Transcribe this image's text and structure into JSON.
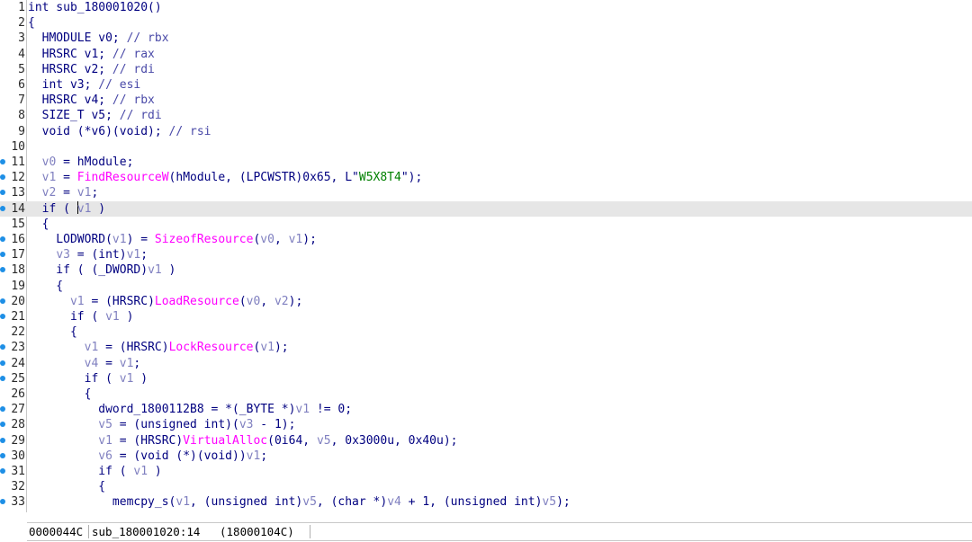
{
  "editor": {
    "function_name": "sub_180001020",
    "lines": [
      {
        "num": "1",
        "bp": false,
        "cur": false,
        "tokens": [
          [
            "int sub_180001020()",
            "k"
          ]
        ]
      },
      {
        "num": "2",
        "bp": false,
        "cur": false,
        "tokens": [
          [
            "{",
            "p"
          ]
        ]
      },
      {
        "num": "3",
        "bp": false,
        "cur": false,
        "tokens": [
          [
            "  HMODULE v0; ",
            "k"
          ],
          [
            "// rbx",
            "c"
          ]
        ]
      },
      {
        "num": "4",
        "bp": false,
        "cur": false,
        "tokens": [
          [
            "  HRSRC v1; ",
            "k"
          ],
          [
            "// rax",
            "c"
          ]
        ]
      },
      {
        "num": "5",
        "bp": false,
        "cur": false,
        "tokens": [
          [
            "  HRSRC v2; ",
            "k"
          ],
          [
            "// rdi",
            "c"
          ]
        ]
      },
      {
        "num": "6",
        "bp": false,
        "cur": false,
        "tokens": [
          [
            "  int v3; ",
            "k"
          ],
          [
            "// esi",
            "c"
          ]
        ]
      },
      {
        "num": "7",
        "bp": false,
        "cur": false,
        "tokens": [
          [
            "  HRSRC v4; ",
            "k"
          ],
          [
            "// rbx",
            "c"
          ]
        ]
      },
      {
        "num": "8",
        "bp": false,
        "cur": false,
        "tokens": [
          [
            "  SIZE_T v5; ",
            "k"
          ],
          [
            "// rdi",
            "c"
          ]
        ]
      },
      {
        "num": "9",
        "bp": false,
        "cur": false,
        "tokens": [
          [
            "  void (*v6)(void); ",
            "k"
          ],
          [
            "// rsi",
            "c"
          ]
        ]
      },
      {
        "num": "10",
        "bp": false,
        "cur": false,
        "tokens": []
      },
      {
        "num": "11",
        "bp": true,
        "cur": false,
        "tokens": [
          [
            "  ",
            "p"
          ],
          [
            "v0",
            "v"
          ],
          [
            " = hModule;",
            "k"
          ]
        ]
      },
      {
        "num": "12",
        "bp": true,
        "cur": false,
        "tokens": [
          [
            "  ",
            "p"
          ],
          [
            "v1",
            "v"
          ],
          [
            " = ",
            "k"
          ],
          [
            "FindResourceW",
            "f"
          ],
          [
            "(hModule, (LPCWSTR)0x65, L\"",
            "k"
          ],
          [
            "W5X8T4",
            "s"
          ],
          [
            "\");",
            "k"
          ]
        ]
      },
      {
        "num": "13",
        "bp": true,
        "cur": false,
        "tokens": [
          [
            "  ",
            "p"
          ],
          [
            "v2",
            "v"
          ],
          [
            " = ",
            "k"
          ],
          [
            "v1",
            "v"
          ],
          [
            ";",
            "k"
          ]
        ]
      },
      {
        "num": "14",
        "bp": true,
        "cur": true,
        "tokens": [
          [
            "  if ( ",
            "k"
          ],
          [
            "CARET",
            "caret"
          ],
          [
            "v1",
            "v"
          ],
          [
            " )",
            "k"
          ]
        ]
      },
      {
        "num": "15",
        "bp": false,
        "cur": false,
        "tokens": [
          [
            "  {",
            "p"
          ]
        ]
      },
      {
        "num": "16",
        "bp": true,
        "cur": false,
        "tokens": [
          [
            "    LODWORD(",
            "k"
          ],
          [
            "v1",
            "v"
          ],
          [
            ") = ",
            "k"
          ],
          [
            "SizeofResource",
            "f"
          ],
          [
            "(",
            "k"
          ],
          [
            "v0",
            "v"
          ],
          [
            ", ",
            "k"
          ],
          [
            "v1",
            "v"
          ],
          [
            ");",
            "k"
          ]
        ]
      },
      {
        "num": "17",
        "bp": true,
        "cur": false,
        "tokens": [
          [
            "    ",
            "p"
          ],
          [
            "v3",
            "v"
          ],
          [
            " = (int)",
            "k"
          ],
          [
            "v1",
            "v"
          ],
          [
            ";",
            "k"
          ]
        ]
      },
      {
        "num": "18",
        "bp": true,
        "cur": false,
        "tokens": [
          [
            "    if ( (_DWORD)",
            "k"
          ],
          [
            "v1",
            "v"
          ],
          [
            " )",
            "k"
          ]
        ]
      },
      {
        "num": "19",
        "bp": false,
        "cur": false,
        "tokens": [
          [
            "    {",
            "p"
          ]
        ]
      },
      {
        "num": "20",
        "bp": true,
        "cur": false,
        "tokens": [
          [
            "      ",
            "p"
          ],
          [
            "v1",
            "v"
          ],
          [
            " = (HRSRC)",
            "k"
          ],
          [
            "LoadResource",
            "f"
          ],
          [
            "(",
            "k"
          ],
          [
            "v0",
            "v"
          ],
          [
            ", ",
            "k"
          ],
          [
            "v2",
            "v"
          ],
          [
            ");",
            "k"
          ]
        ]
      },
      {
        "num": "21",
        "bp": true,
        "cur": false,
        "tokens": [
          [
            "      if ( ",
            "k"
          ],
          [
            "v1",
            "v"
          ],
          [
            " )",
            "k"
          ]
        ]
      },
      {
        "num": "22",
        "bp": false,
        "cur": false,
        "tokens": [
          [
            "      {",
            "p"
          ]
        ]
      },
      {
        "num": "23",
        "bp": true,
        "cur": false,
        "tokens": [
          [
            "        ",
            "p"
          ],
          [
            "v1",
            "v"
          ],
          [
            " = (HRSRC)",
            "k"
          ],
          [
            "LockResource",
            "f"
          ],
          [
            "(",
            "k"
          ],
          [
            "v1",
            "v"
          ],
          [
            ");",
            "k"
          ]
        ]
      },
      {
        "num": "24",
        "bp": true,
        "cur": false,
        "tokens": [
          [
            "        ",
            "p"
          ],
          [
            "v4",
            "v"
          ],
          [
            " = ",
            "k"
          ],
          [
            "v1",
            "v"
          ],
          [
            ";",
            "k"
          ]
        ]
      },
      {
        "num": "25",
        "bp": true,
        "cur": false,
        "tokens": [
          [
            "        if ( ",
            "k"
          ],
          [
            "v1",
            "v"
          ],
          [
            " )",
            "k"
          ]
        ]
      },
      {
        "num": "26",
        "bp": false,
        "cur": false,
        "tokens": [
          [
            "        {",
            "p"
          ]
        ]
      },
      {
        "num": "27",
        "bp": true,
        "cur": false,
        "tokens": [
          [
            "          dword_1800112B8 = *(_BYTE *)",
            "k"
          ],
          [
            "v1",
            "v"
          ],
          [
            " != 0;",
            "k"
          ]
        ]
      },
      {
        "num": "28",
        "bp": true,
        "cur": false,
        "tokens": [
          [
            "          ",
            "p"
          ],
          [
            "v5",
            "v"
          ],
          [
            " = (unsigned int)(",
            "k"
          ],
          [
            "v3",
            "v"
          ],
          [
            " - 1);",
            "k"
          ]
        ]
      },
      {
        "num": "29",
        "bp": true,
        "cur": false,
        "tokens": [
          [
            "          ",
            "p"
          ],
          [
            "v1",
            "v"
          ],
          [
            " = (HRSRC)",
            "k"
          ],
          [
            "VirtualAlloc",
            "f"
          ],
          [
            "(0i64, ",
            "k"
          ],
          [
            "v5",
            "v"
          ],
          [
            ", 0x3000u, 0x40u);",
            "k"
          ]
        ]
      },
      {
        "num": "30",
        "bp": true,
        "cur": false,
        "tokens": [
          [
            "          ",
            "p"
          ],
          [
            "v6",
            "v"
          ],
          [
            " = (void (*)(void))",
            "k"
          ],
          [
            "v1",
            "v"
          ],
          [
            ";",
            "k"
          ]
        ]
      },
      {
        "num": "31",
        "bp": true,
        "cur": false,
        "tokens": [
          [
            "          if ( ",
            "k"
          ],
          [
            "v1",
            "v"
          ],
          [
            " )",
            "k"
          ]
        ]
      },
      {
        "num": "32",
        "bp": false,
        "cur": false,
        "tokens": [
          [
            "          {",
            "p"
          ]
        ]
      },
      {
        "num": "33",
        "bp": true,
        "cur": false,
        "tokens": [
          [
            "            memcpy_s(",
            "k"
          ],
          [
            "v1",
            "v"
          ],
          [
            ", (unsigned int)",
            "k"
          ],
          [
            "v5",
            "v"
          ],
          [
            ", (char *)",
            "k"
          ],
          [
            "v4",
            "v"
          ],
          [
            " + 1, (unsigned int)",
            "k"
          ],
          [
            "v5",
            "v"
          ],
          [
            ");",
            "k"
          ]
        ]
      }
    ]
  },
  "status_bar": {
    "offset": "0000044C",
    "location": "sub_180001020:14",
    "address": "(18000104C)"
  },
  "colors": {
    "breakpoint_dot": "#1e8fe6",
    "current_line_bg": "#e6e6e6",
    "keyword": "#000080",
    "variable": "#8080c0",
    "function_call": "#ff00ff",
    "string": "#008000"
  }
}
